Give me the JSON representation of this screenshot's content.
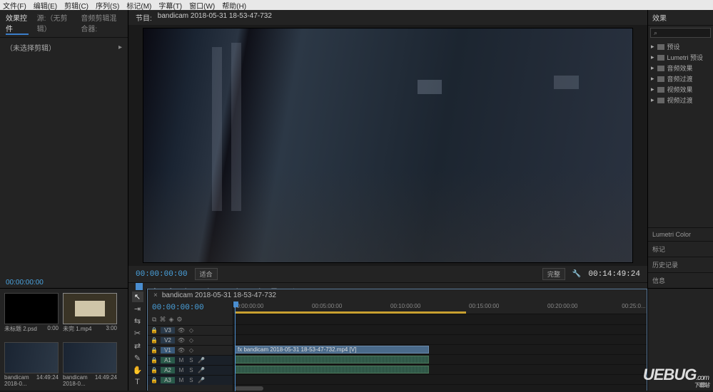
{
  "menu": {
    "file": "文件(F)",
    "edit": "编辑(E)",
    "clip": "剪辑(C)",
    "sequence": "序列(S)",
    "marker": "标记(M)",
    "subtitle": "字幕(T)",
    "window": "窗口(W)",
    "help": "帮助(H)"
  },
  "left_panel": {
    "tabs": {
      "effect_controls": "效果控件",
      "source_none": "源:（无剪辑）",
      "audio_mixer": "音频剪辑混合器:"
    },
    "no_selection": "（未选择剪辑）",
    "timecode": "00:00:00:00"
  },
  "monitor": {
    "title_prefix": "节目:",
    "sequence_name": "bandicam 2018-05-31 18-53-47-732",
    "timecode_in": "00:00:00:00",
    "fit_label": "适合",
    "scale_label": "完整",
    "timecode_dur": "00:14:49:24"
  },
  "effects_panel": {
    "title": "效果",
    "search_placeholder": "",
    "items": [
      "预设",
      "Lumetri 预设",
      "音频效果",
      "音频过渡",
      "视频效果",
      "视频过渡"
    ],
    "sections": {
      "lumetri": "Lumetri Color",
      "markers": "标记",
      "history": "历史记录",
      "info": "信息"
    }
  },
  "project": {
    "thumbs": [
      {
        "name": "未标题 2.psd",
        "dur": "0:00"
      },
      {
        "name": "未完 1.mp4",
        "dur": "3:00"
      },
      {
        "name": "bandicam 2018-0...",
        "dur": "14:49:24"
      },
      {
        "name": "bandicam 2018-0...",
        "dur": "14:49:24"
      }
    ]
  },
  "timeline": {
    "sequence_name": "bandicam 2018-05-31 18-53-47-732",
    "timecode": "00:00:00:00",
    "ticks": [
      "00:00:00:00",
      "00:05:00:00",
      "00:10:00:00",
      "00:15:00:00",
      "00:20:00:00",
      "00:25:0..."
    ],
    "tracks": {
      "v3": "V3",
      "v2": "V2",
      "v1": "V1",
      "a1": "A1",
      "a2": "A2",
      "a3": "A3"
    },
    "clip_name": "bandicam 2018-05-31 18-53-47-732.mp4 [V]",
    "track_btns": {
      "mute": "M",
      "solo": "S"
    }
  },
  "watermark": {
    "brand": "UEBUG",
    "suffix": ".com",
    "tag": "下载站"
  }
}
